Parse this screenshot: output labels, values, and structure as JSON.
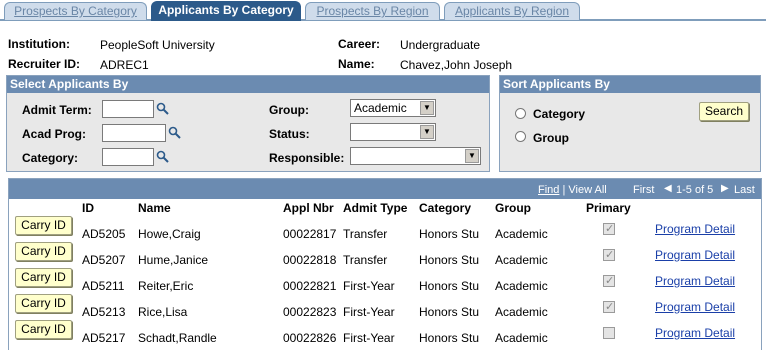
{
  "tabs": [
    {
      "label": "Prospects By Category",
      "active": false
    },
    {
      "label": "Applicants By Category",
      "active": true
    },
    {
      "label": "Prospects By Region",
      "active": false
    },
    {
      "label": "Applicants By Region",
      "active": false
    }
  ],
  "header": {
    "institution_label": "Institution:",
    "institution_value": "PeopleSoft University",
    "recruiter_label": "Recruiter ID:",
    "recruiter_value": "ADREC1",
    "career_label": "Career:",
    "career_value": "Undergraduate",
    "name_label": "Name:",
    "name_value": "Chavez,John Joseph"
  },
  "select": {
    "title": "Select Applicants By",
    "admit_term_label": "Admit Term:",
    "acad_prog_label": "Acad Prog:",
    "category_label": "Category:",
    "group_label": "Group:",
    "group_value": "Academic",
    "status_label": "Status:",
    "status_value": "",
    "responsible_label": "Responsible:",
    "responsible_value": ""
  },
  "sort": {
    "title": "Sort Applicants By",
    "option_category": "Category",
    "option_group": "Group",
    "search_label": "Search"
  },
  "grid": {
    "nav_find": "Find",
    "nav_sep": "|",
    "nav_view_all": "View All",
    "nav_first": "First",
    "nav_range": "1-5 of 5",
    "nav_last": "Last",
    "headers": {
      "id": "ID",
      "name": "Name",
      "appl_nbr": "Appl Nbr",
      "admit_type": "Admit Type",
      "category": "Category",
      "group": "Group",
      "primary": "Primary"
    },
    "carry_label": "Carry ID",
    "detail_label": "Program Detail",
    "rows": [
      {
        "id": "AD5205",
        "name": "Howe,Craig",
        "appl_nbr": "00022817",
        "admit_type": "Transfer",
        "category": "Honors Stu",
        "group": "Academic",
        "primary": "✓"
      },
      {
        "id": "AD5207",
        "name": "Hume,Janice",
        "appl_nbr": "00022818",
        "admit_type": "Transfer",
        "category": "Honors Stu",
        "group": "Academic",
        "primary": "✓"
      },
      {
        "id": "AD5211",
        "name": "Reiter,Eric",
        "appl_nbr": "00022821",
        "admit_type": "First-Year",
        "category": "Honors Stu",
        "group": "Academic",
        "primary": "✓"
      },
      {
        "id": "AD5213",
        "name": "Rice,Lisa",
        "appl_nbr": "00022823",
        "admit_type": "First-Year",
        "category": "Honors Stu",
        "group": "Academic",
        "primary": "✓"
      },
      {
        "id": "AD5217",
        "name": "Schadt,Randle",
        "appl_nbr": "00022826",
        "admit_type": "First-Year",
        "category": "Honors Stu",
        "group": "Academic",
        "primary": ""
      }
    ]
  }
}
